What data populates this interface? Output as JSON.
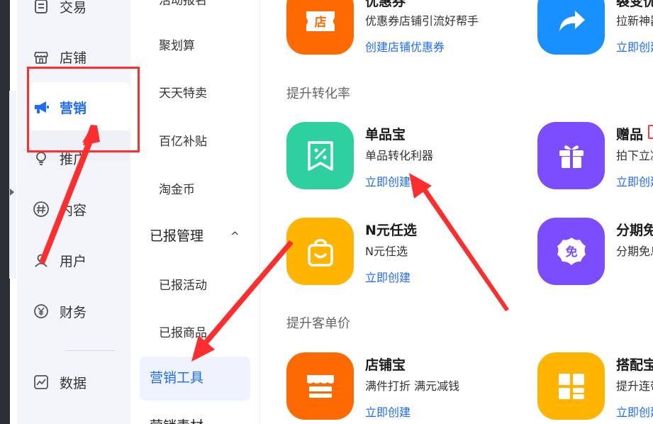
{
  "nav": {
    "items": [
      {
        "label": "交易",
        "icon": "file-list-icon"
      },
      {
        "label": "店铺",
        "icon": "storefront-icon"
      },
      {
        "label": "营销",
        "icon": "megaphone-icon",
        "active": true
      },
      {
        "label": "推广",
        "icon": "lightbulb-icon"
      },
      {
        "label": "内容",
        "icon": "hashtag-icon"
      },
      {
        "label": "用户",
        "icon": "user-icon"
      },
      {
        "label": "财务",
        "icon": "yen-icon"
      },
      {
        "label": "数据",
        "icon": "chart-icon"
      }
    ]
  },
  "subnav": {
    "items": [
      {
        "label": "活动报名"
      },
      {
        "label": "聚划算"
      },
      {
        "label": "天天特卖"
      },
      {
        "label": "百亿补贴"
      },
      {
        "label": "淘金币"
      }
    ],
    "group": {
      "label": "已报管理",
      "caret": "^"
    },
    "group_items": [
      {
        "label": "已报活动"
      },
      {
        "label": "已报商品"
      }
    ],
    "active": {
      "label": "营销工具"
    },
    "bottom_partial": {
      "label": "营销素材"
    }
  },
  "main": {
    "top_cards": [
      {
        "name": "优惠券",
        "desc": "优惠券店铺引流好帮手",
        "link": "创建店铺优惠券",
        "icon": "shop-ticket-icon",
        "icon_text": "店",
        "color": "#ff6a00"
      },
      {
        "name": "裂变优惠",
        "desc": "拉新神器",
        "link": "立即创建",
        "icon": "share-arrow-icon",
        "color": "#1890ff"
      }
    ],
    "section_conversion": "提升转化率",
    "conversion_cards": [
      {
        "name": "单品宝",
        "desc": "单品转化利器",
        "link": "立即创建",
        "icon": "percent-tag-icon",
        "color": "#2fd0a0"
      },
      {
        "name": "赠品",
        "desc": "拍下立减",
        "link": "立即创建",
        "icon": "gift-icon",
        "color": "#7c4dff"
      },
      {
        "name": "N元任选",
        "desc": "N元任选",
        "link": "立即创建",
        "icon": "shopping-bag-icon",
        "color": "#ffb400"
      },
      {
        "name": "分期免息",
        "desc": "分期免息",
        "link": "",
        "icon": "free-badge-icon",
        "icon_text": "免",
        "color": "#7c4dff"
      }
    ],
    "section_avg_price": "提升客单价",
    "avg_price_cards": [
      {
        "name": "店铺宝",
        "desc": "满件打折 满元减钱",
        "link": "立即创建",
        "icon": "shop-awning-icon",
        "color": "#ff6a00"
      },
      {
        "name": "搭配宝",
        "desc": "提升连带",
        "link": "立即创建",
        "icon": "grid-layout-icon",
        "color": "#ffb400"
      }
    ]
  }
}
